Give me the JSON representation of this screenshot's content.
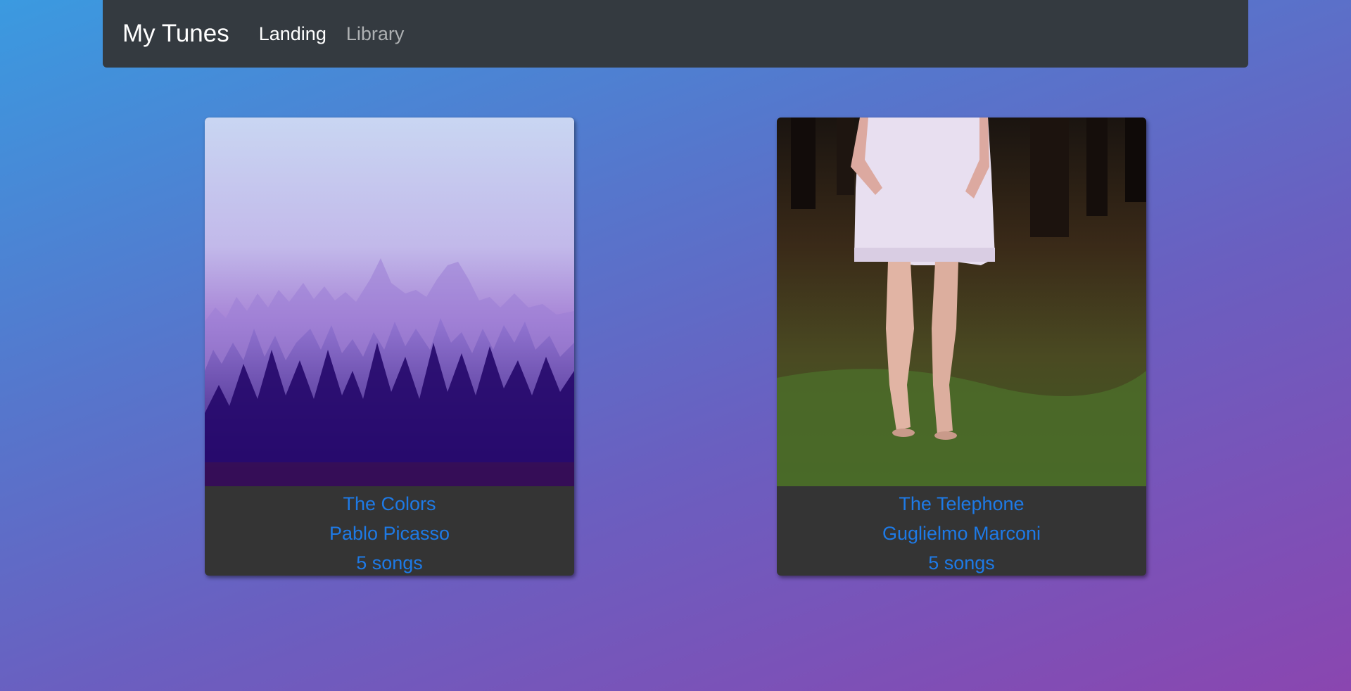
{
  "navbar": {
    "brand": "My Tunes",
    "links": [
      {
        "label": "Landing",
        "active": true
      },
      {
        "label": "Library",
        "active": false
      }
    ]
  },
  "albums": [
    {
      "title": "The Colors",
      "artist": "Pablo Picasso",
      "songs": "5 songs",
      "cover_icon": "misty-purple-forest-image"
    },
    {
      "title": "The Telephone",
      "artist": "Guglielmo Marconi",
      "songs": "5 songs",
      "cover_icon": "girl-in-white-dress-forest-image"
    }
  ],
  "colors": {
    "navbar_bg": "#343a40",
    "card_bg": "#343434",
    "link_color": "#1e7ae6",
    "gradient_start": "#3b9ae0",
    "gradient_end": "#8a46b0"
  }
}
